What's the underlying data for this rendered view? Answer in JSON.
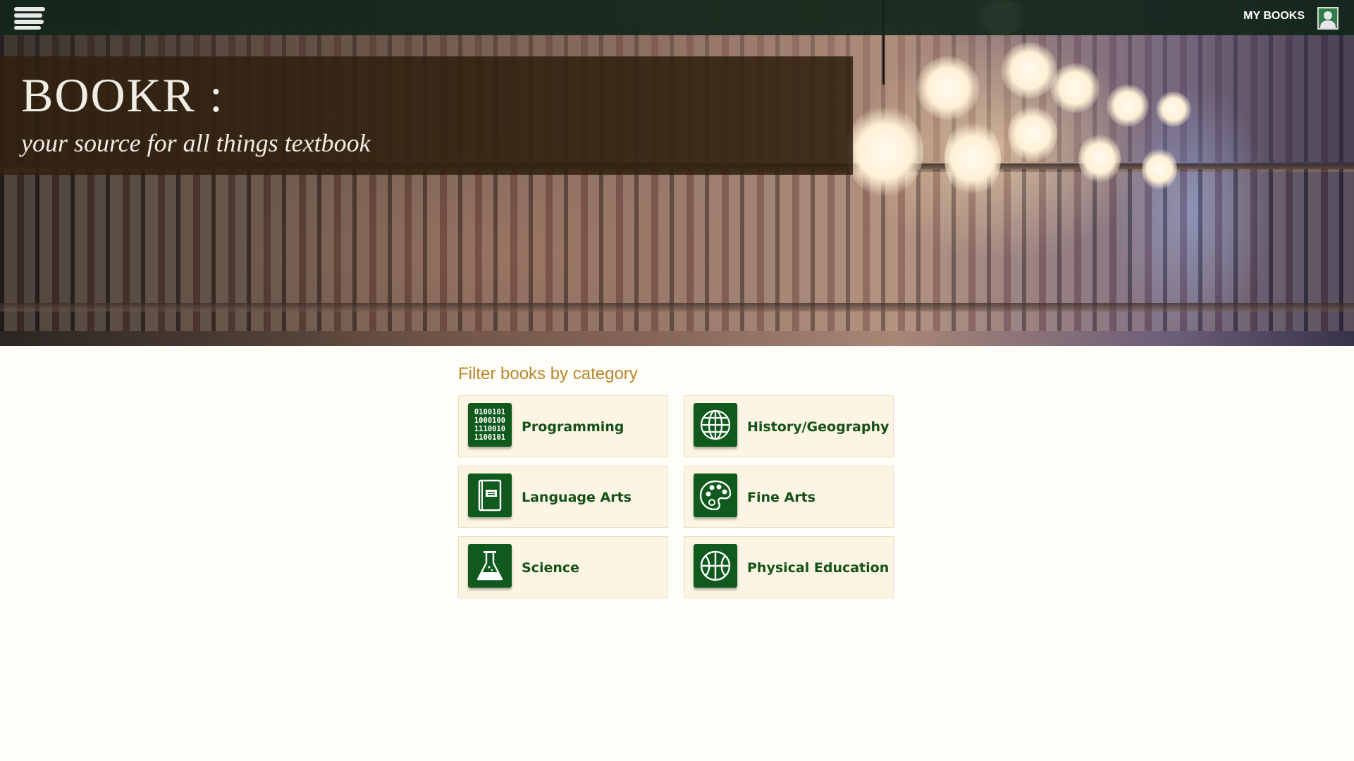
{
  "header": {
    "mybooks_label": "MY BOOKS"
  },
  "hero": {
    "title": "BOOKR :",
    "subtitle": "your source for all things textbook"
  },
  "filter": {
    "heading": "Filter books by category",
    "binary_text": "0100101\n1000100\n1110010\n1100101",
    "categories": [
      {
        "label": "Programming",
        "icon": "binary-code-icon"
      },
      {
        "label": "History/Geography",
        "icon": "globe-icon"
      },
      {
        "label": "Language Arts",
        "icon": "book-icon"
      },
      {
        "label": "Fine Arts",
        "icon": "palette-icon"
      },
      {
        "label": "Science",
        "icon": "flask-icon"
      },
      {
        "label": "Physical Education",
        "icon": "basketball-icon"
      }
    ]
  },
  "colors": {
    "accent_green": "#0f5a1c",
    "label_green": "#135218",
    "heading_gold": "#b8862c",
    "card_bg": "#fcf5e3"
  }
}
